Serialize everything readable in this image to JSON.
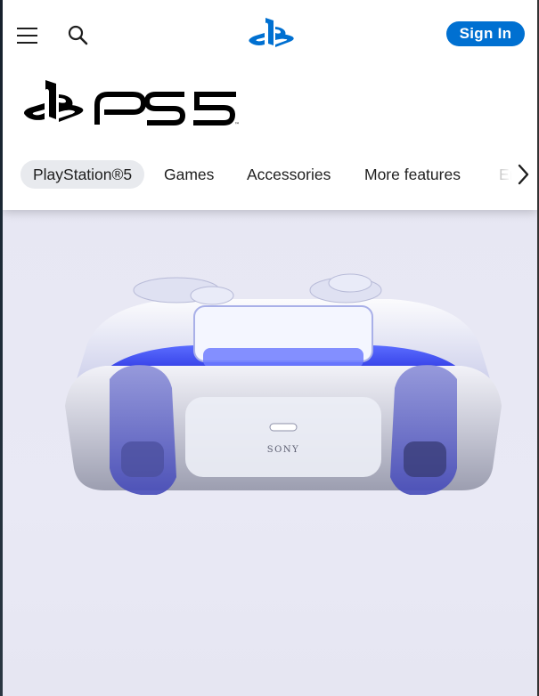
{
  "header": {
    "signin_label": "Sign In",
    "brand_accent": "#0070d1"
  },
  "icons": {
    "menu": "hamburger-menu",
    "search": "magnifier",
    "playstation": "playstation-logo",
    "next": "chevron-right"
  },
  "logo": {
    "text": "PS5"
  },
  "nav": {
    "tabs": [
      {
        "label": "PlayStation®5",
        "active": true
      },
      {
        "label": "Games",
        "active": false
      },
      {
        "label": "Accessories",
        "active": false
      },
      {
        "label": "More features",
        "active": false
      },
      {
        "label": "En",
        "active": false
      }
    ]
  },
  "hero": {
    "brand_text": "SONY"
  }
}
